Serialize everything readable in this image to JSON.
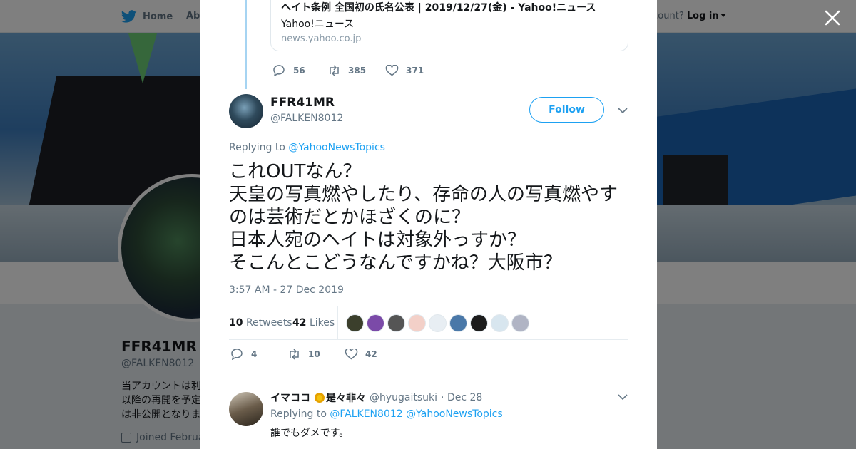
{
  "topbar": {
    "home_label": "Home",
    "about_label": "Abo",
    "account_prompt": "ccount?",
    "login_label": "Log in"
  },
  "profile": {
    "name": "FFR41MR",
    "handle": "@FALKEN8012",
    "bio_lines": "当アカウントは利\n以降の再開を予定\nは非公開となりま",
    "joined": "Joined Februa"
  },
  "modal": {
    "link_card": {
      "title": "ヘイト条例 全国初の氏名公表 | 2019/12/27(金) - Yahoo!ニュース",
      "description": "Yahoo!ニュース",
      "domain": "news.yahoo.co.jp"
    },
    "parent_actions": {
      "replies": "56",
      "retweets": "385",
      "likes": "371"
    },
    "tweet": {
      "author_name": "FFR41MR",
      "author_handle": "@FALKEN8012",
      "follow_label": "Follow",
      "replying_prefix": "Replying to",
      "replying_to": "@YahooNewsTopics",
      "text": "これOUTなん？\n天皇の写真燃やしたり、存命の人の写真燃やすのは芸術だとかほざくのに？\n日本人宛のヘイトは対象外っすか？\nそこんとこどうなんですかね？大阪市？",
      "timestamp": "3:57 AM - 27 Dec 2019",
      "retweet_count": "10",
      "retweet_label": "Retweets",
      "like_count": "42",
      "like_label": "Likes",
      "likers": [
        {
          "color": "#3b3f2c"
        },
        {
          "color": "#7b4aa8"
        },
        {
          "color": "#555555"
        },
        {
          "color": "#f3d0c8"
        },
        {
          "color": "#e8eef3"
        },
        {
          "color": "#4a78a8"
        },
        {
          "color": "#1c1c1c"
        },
        {
          "color": "#d8e6ef"
        },
        {
          "color": "#b0b4c4"
        }
      ],
      "actions": {
        "replies": "4",
        "retweets": "10",
        "likes": "42"
      }
    },
    "reply": {
      "author_name": "イマココ",
      "author_suffix": "是々非々",
      "author_handle": "@hyugaitsuki",
      "date": "· Dec 28",
      "replying_prefix": "Replying to",
      "replying_to_1": "@FALKEN8012",
      "replying_to_2": "@YahooNewsTopics",
      "text": "誰でもダメです。"
    }
  },
  "colors": {
    "accent": "#1da1f2",
    "thread_line": "#a6d4f2",
    "muted": "#657786",
    "overlay": "rgba(0,0,0,0.5)"
  }
}
